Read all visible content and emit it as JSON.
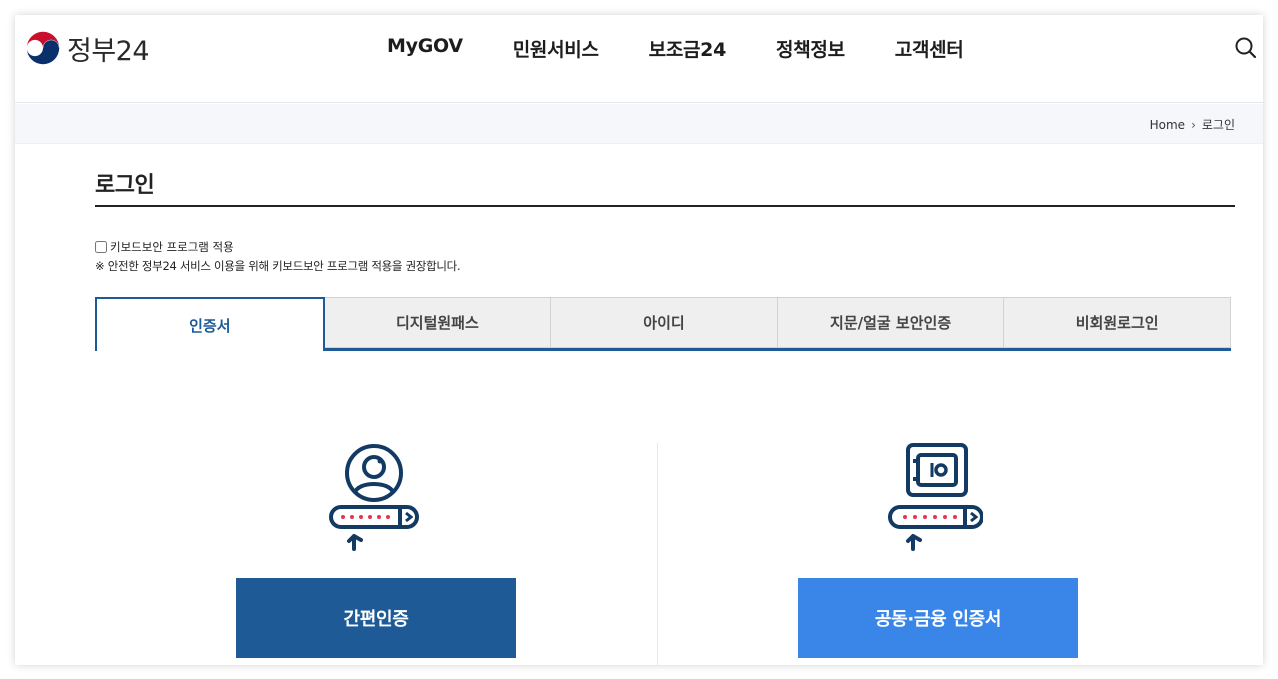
{
  "header": {
    "logo_text": "정부24",
    "nav": [
      "MyGOV",
      "민원서비스",
      "보조금24",
      "정책정보",
      "고객센터"
    ],
    "search_icon": "search-icon"
  },
  "breadcrumb": {
    "home": "Home",
    "current": "로그인"
  },
  "page": {
    "title": "로그인"
  },
  "keyboard_security": {
    "label": "키보드보안 프로그램 적용",
    "checked": false,
    "note": "※ 안전한 정부24 서비스 이용을 위해 키보드보안 프로그램 적용을 권장합니다."
  },
  "tabs": [
    {
      "label": "인증서",
      "active": true
    },
    {
      "label": "디지털원패스",
      "active": false
    },
    {
      "label": "아이디",
      "active": false
    },
    {
      "label": "지문/얼굴 보안인증",
      "active": false
    },
    {
      "label": "비회원로그인",
      "active": false
    }
  ],
  "login_options": {
    "simple_auth": {
      "label": "간편인증",
      "icon": "user-password-icon"
    },
    "joint_cert": {
      "label": "공동·금융 인증서",
      "icon": "safe-password-icon"
    }
  },
  "colors": {
    "primary": "#1d5a96",
    "secondary": "#3a86e8",
    "accent_dots": "#e5364a"
  }
}
